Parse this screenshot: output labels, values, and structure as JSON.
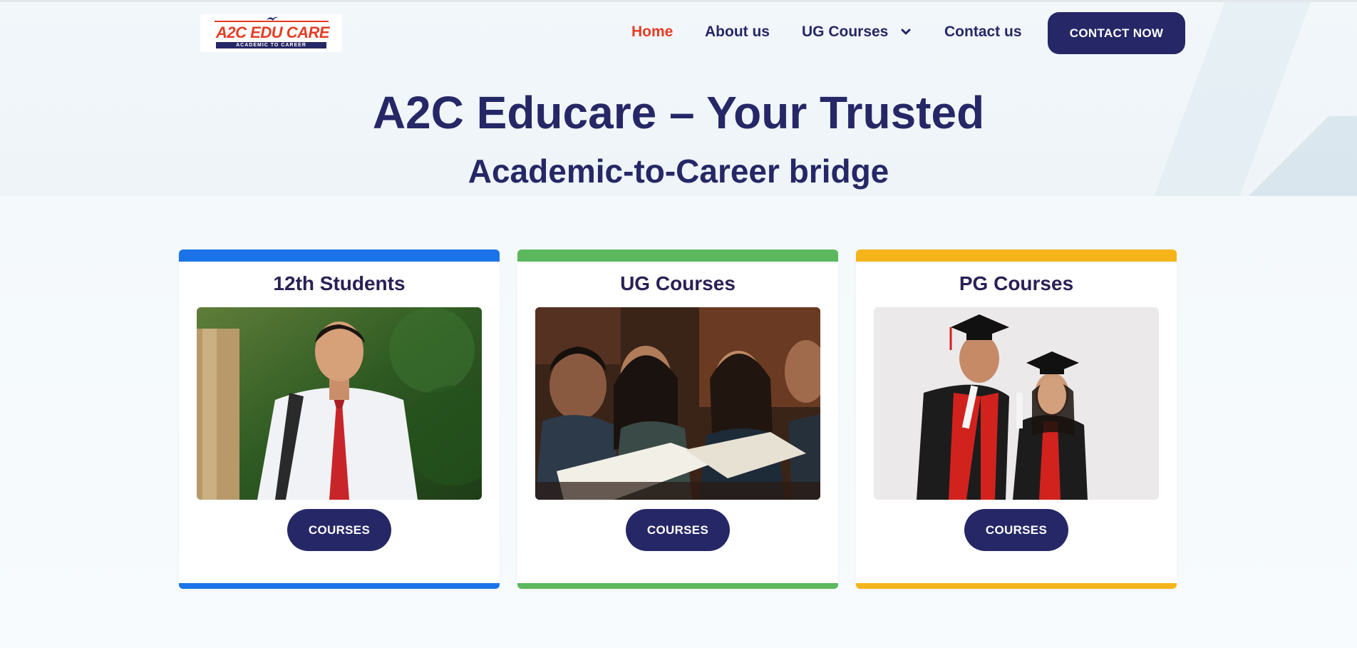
{
  "header": {
    "logo": {
      "name_part1": "A2C",
      "name_part2": "EDU CARE",
      "tagline": "ACADEMIC TO CAREER"
    },
    "nav": [
      {
        "label": "Home",
        "active": true
      },
      {
        "label": "About us",
        "active": false
      },
      {
        "label": "UG Courses",
        "active": false,
        "icon": "chevron-down-icon"
      },
      {
        "label": "Contact us",
        "active": false
      }
    ],
    "cta_label": "CONTACT NOW"
  },
  "hero": {
    "title": "A2C Educare – Your Trusted",
    "subtitle": "Academic-to-Career bridge"
  },
  "cards": [
    {
      "title": "12th Students",
      "button": "COURSES",
      "accent": "#1a73e8"
    },
    {
      "title": "UG Courses",
      "button": "COURSES",
      "accent": "#5cb85c"
    },
    {
      "title": "PG Courses",
      "button": "COURSES",
      "accent": "#f4b41a"
    }
  ],
  "colors": {
    "primary": "#262766",
    "active": "#e53d24"
  }
}
